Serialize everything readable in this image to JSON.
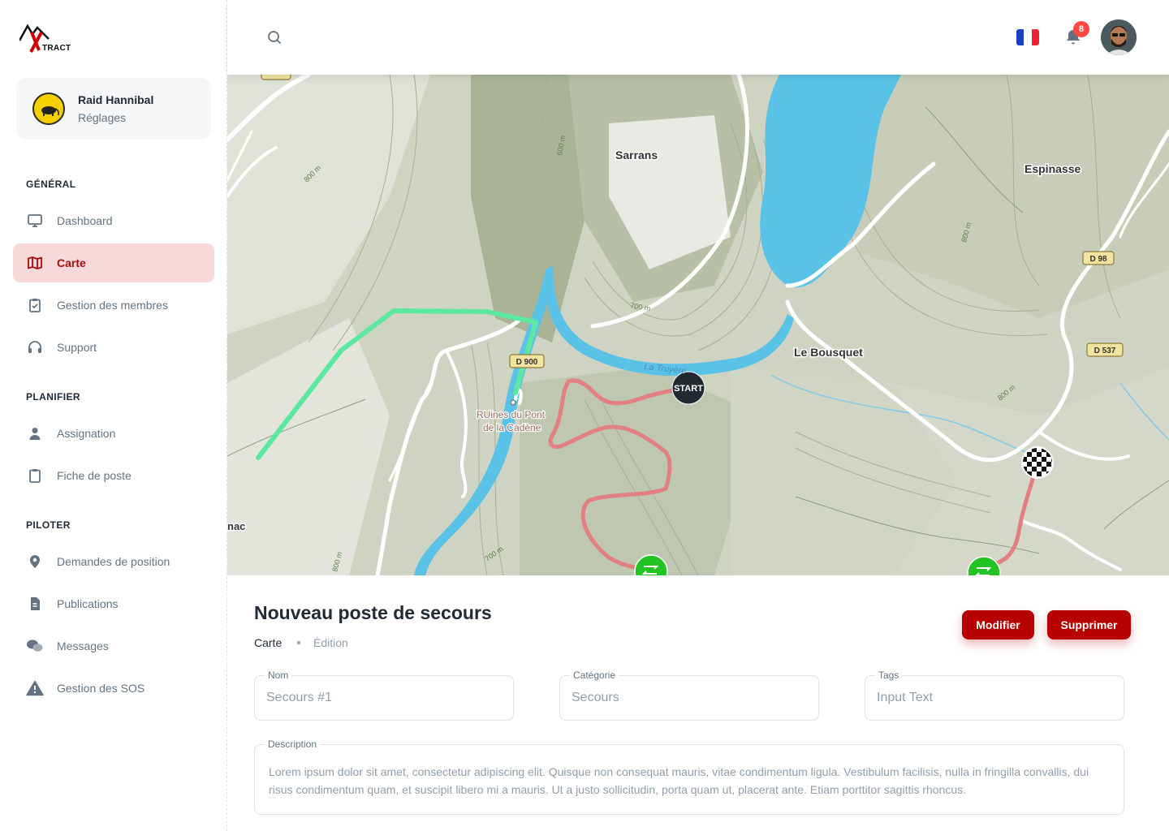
{
  "brand": {
    "logo_text": "TRACT"
  },
  "org": {
    "name": "Raid Hannibal",
    "subtitle": "Réglages"
  },
  "sidebar": {
    "sections": [
      {
        "title": "GÉNÉRAL"
      },
      {
        "title": "PLANIFIER"
      },
      {
        "title": "PILOTER"
      }
    ],
    "items": [
      {
        "label": "Dashboard",
        "icon": "monitor-icon"
      },
      {
        "label": "Carte",
        "icon": "map-icon",
        "active": true
      },
      {
        "label": "Gestion des membres",
        "icon": "clipboard-check-icon"
      },
      {
        "label": "Support",
        "icon": "headset-icon"
      },
      {
        "label": "Assignation",
        "icon": "user-icon"
      },
      {
        "label": "Fiche de poste",
        "icon": "clipboard-icon"
      },
      {
        "label": "Demandes de position",
        "icon": "location-pin-icon"
      },
      {
        "label": "Publications",
        "icon": "document-icon"
      },
      {
        "label": "Messages",
        "icon": "chat-bubbles-icon"
      },
      {
        "label": "Gestion des SOS",
        "icon": "warning-icon"
      }
    ]
  },
  "header": {
    "notifications_count": "8",
    "language": "fr"
  },
  "map": {
    "labels": {
      "sarrans": "Sarrans",
      "espinasse": "Espinasse",
      "le_bousquet": "Le Bousquet",
      "ruines_1": "RUines du Pont",
      "ruines_2": "de la Cadène",
      "river": "La Truyère",
      "edge": "nac",
      "d98": "D 98",
      "d537": "D 537",
      "d900": "D 900",
      "contour_800a": "800 m",
      "contour_800b": "800 m",
      "contour_800c": "800 m",
      "contour_800d": "800 m",
      "contour_600": "600 m",
      "contour_700a": "700 m",
      "contour_700b": "700 m"
    },
    "markers": {
      "start": "START"
    },
    "colors": {
      "water": "#5bc2e7",
      "track_green": "#5ce8a0",
      "track_red": "#e08080",
      "marker_green": "#22c322"
    }
  },
  "page": {
    "title": "Nouveau poste de secours",
    "breadcrumb": [
      "Carte",
      "Édition"
    ]
  },
  "actions": {
    "edit": "Modifier",
    "delete": "Supprimer"
  },
  "form": {
    "name": {
      "label": "Nom",
      "value": "Secours #1"
    },
    "category": {
      "label": "Catégorie",
      "value": "Secours"
    },
    "tags": {
      "label": "Tags",
      "value": "Input Text"
    },
    "description": {
      "label": "Description",
      "value": "Lorem ipsum dolor sit amet, consectetur adipiscing elit. Quisque non consequat mauris, vitae condimentum ligula. Vestibulum facilisis, nulla in fringilla convallis, dui risus condimentum quam, et suscipit libero mi a mauris. Ut a justo sollicitudin, porta quam ut, placerat ante. Etiam porttitor sagittis rhoncus."
    }
  },
  "theme": {
    "accent": "#b70000",
    "active_bg": "#f7d9da"
  }
}
